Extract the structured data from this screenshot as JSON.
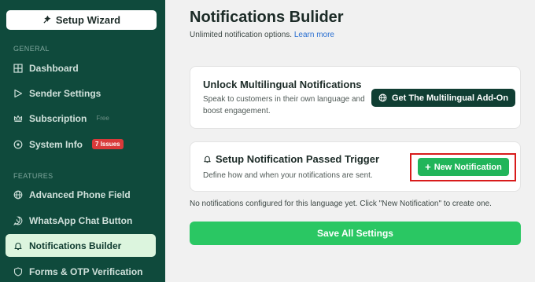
{
  "sidebar": {
    "wizard_label": "Setup Wizard",
    "general_label": "GENERAL",
    "features_label": "FEATURES",
    "items": [
      {
        "label": "Dashboard",
        "icon": "grid-icon"
      },
      {
        "label": "Sender Settings",
        "icon": "send-icon"
      },
      {
        "label": "Subscription",
        "icon": "crown-icon",
        "tag": "Free"
      },
      {
        "label": "System Info",
        "icon": "info-icon",
        "badge": "7 Issues"
      },
      {
        "label": "Advanced Phone Field",
        "icon": "globe-icon"
      },
      {
        "label": "WhatsApp Chat Button",
        "icon": "whatsapp-icon"
      },
      {
        "label": "Notifications Builder",
        "icon": "bell-icon",
        "active": true
      },
      {
        "label": "Forms & OTP Verification",
        "icon": "shield-icon"
      }
    ]
  },
  "main": {
    "title": "Notifications Bulider",
    "subtitle": "Unlimited notification options.",
    "learn_more": "Learn more",
    "multilingual": {
      "title": "Unlock Multilingual Notifications",
      "desc": "Speak to customers in their own language and boost engagement.",
      "button": "Get The Multilingual Add-On"
    },
    "trigger": {
      "title": "Setup Notification Passed Trigger",
      "desc": "Define how and when your notifications are sent.",
      "button": "New Notification"
    },
    "empty_message": "No notifications configured for this language yet. Click \"New Notification\" to create one.",
    "save_button": "Save All Settings"
  },
  "colors": {
    "sidebar_bg": "#0f4a3c",
    "active_bg": "#dcf5de",
    "primary_green": "#21b55a",
    "save_green": "#2ac763",
    "highlight_red": "#d81b1b"
  }
}
